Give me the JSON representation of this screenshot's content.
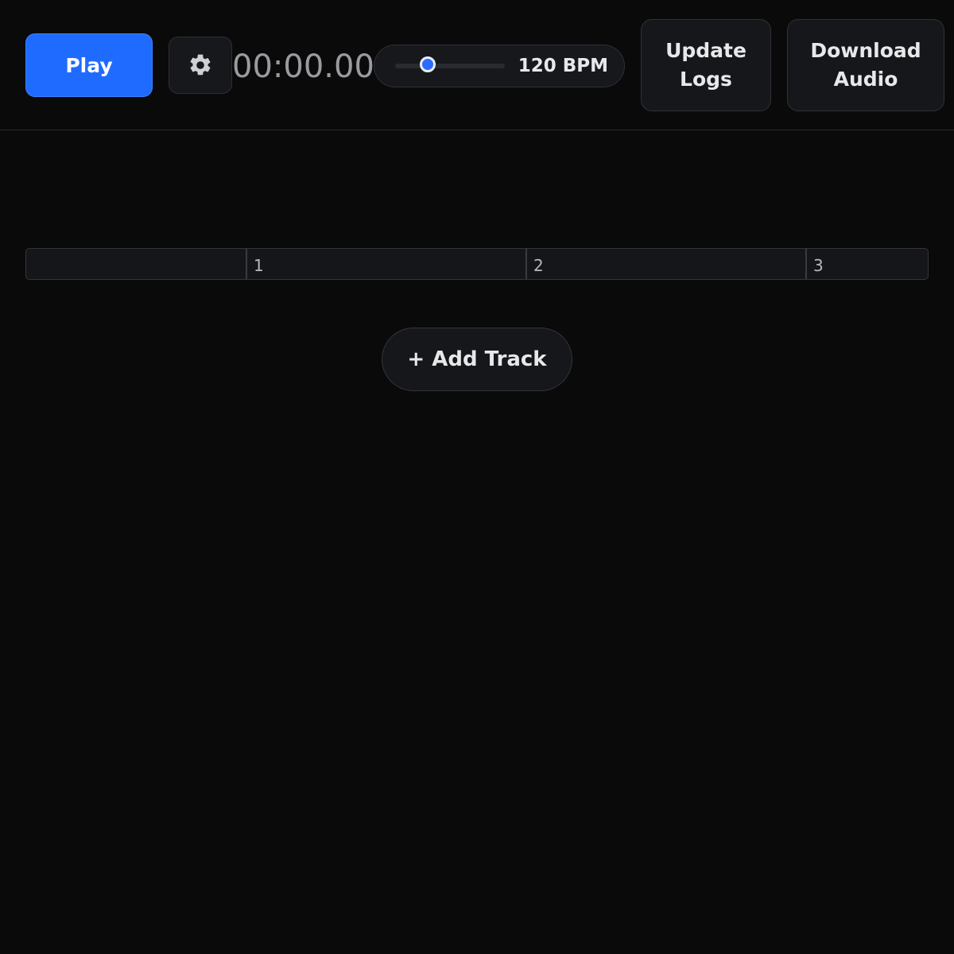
{
  "toolbar": {
    "play_label": "Play",
    "settings_icon": "gear-icon",
    "time": "00:00.00",
    "tempo": {
      "value_fraction": 0.3,
      "label": "120 BPM"
    },
    "update_logs_line1": "Update",
    "update_logs_line2": "Logs",
    "download_audio_line1": "Download",
    "download_audio_line2": "Audio"
  },
  "timeline": {
    "bars": [
      "1",
      "2",
      "3"
    ]
  },
  "add_track_label": "+ Add Track",
  "colors": {
    "accent": "#1f6bff",
    "background": "#0a0a0b"
  }
}
